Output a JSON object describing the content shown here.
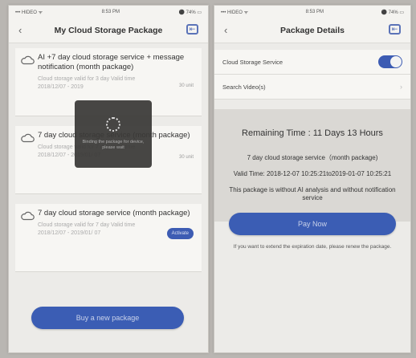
{
  "left_screen": {
    "status": {
      "carrier": "••• HIDEO ᯤ",
      "time": "8:53 PM",
      "battery": "⚫ 74% ▭"
    },
    "title": "My Cloud Storage Package",
    "packages": [
      {
        "title": "AI +7 day cloud storage service + message notification (month package)",
        "detail": "Cloud storage valid for 3 day Valid time 2018/12/07 - 2019",
        "status": "30 unit"
      },
      {
        "title": "7 day cloud storage service (month package)",
        "detail": "Cloud storage valid for 7 day Valid time 2018/12/07 - 2019/01/ 07",
        "status": "30 unit"
      },
      {
        "title": "7 day cloud storage service (month package)",
        "detail": "Cloud storage valid for 7 day Valid time 2018/12/07 - 2019/01/ 07",
        "status": "Activate"
      }
    ],
    "toast_text": "Binding the package for device, please wait",
    "buy_button": "Buy a new package"
  },
  "right_screen": {
    "status": {
      "carrier": "••• HIDEO ᯤ",
      "time": "8:53 PM",
      "battery": "⚫ 74% ▭"
    },
    "title": "Package Details",
    "cloud_storage_label": "Cloud Storage Service",
    "cloud_storage_enabled": true,
    "search_label": "Search Video(s)",
    "remaining_label": "Remaining Time :",
    "remaining_value": "11 Days 13 Hours",
    "package_name": "7 day cloud storage service（month package)",
    "valid_time": "Valid Time: 2018-12-07 10:25:21to2019-01-07 10:25:21",
    "ai_note": "This package is without AI analysis and without notification service",
    "pay_button": "Pay Now",
    "extend_note": "If you want to extend the expiration date, please renew the package."
  },
  "colors": {
    "accent": "#3b5db4",
    "background": "#ecebe8"
  }
}
